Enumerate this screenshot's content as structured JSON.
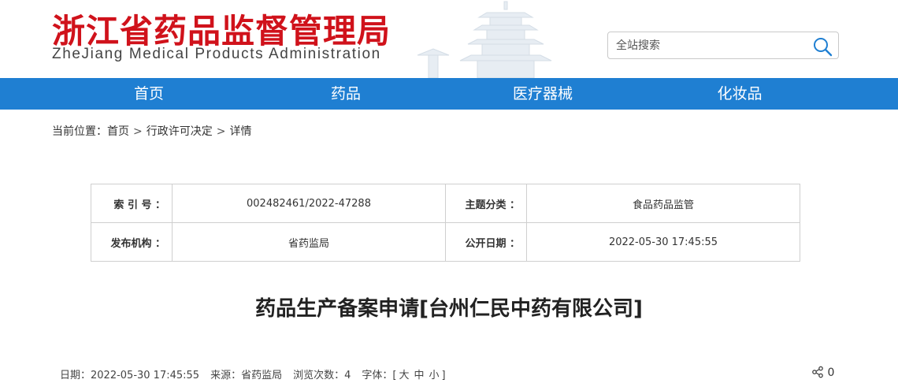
{
  "header": {
    "title_cn": "浙江省药品监督管理局",
    "title_en": "ZheJiang Medical Products Administration",
    "brand_color": "#d0121b",
    "search": {
      "placeholder": "全站搜索",
      "icon": "search-icon"
    }
  },
  "nav": {
    "bg_color": "#1f7fd2",
    "items": [
      {
        "label": "首页"
      },
      {
        "label": "药品"
      },
      {
        "label": "医疗器械"
      },
      {
        "label": "化妆品"
      }
    ]
  },
  "breadcrumb": {
    "prefix": "当前位置：",
    "items": [
      "首页",
      "行政许可决定",
      "详情"
    ],
    "separator": ">"
  },
  "info": {
    "rows": [
      [
        {
          "label": "索 引 号 ：",
          "value": "002482461/2022-47288"
        },
        {
          "label": "主题分类 ：",
          "value": "食品药品监管"
        }
      ],
      [
        {
          "label": "发布机构 ：",
          "value": "省药监局"
        },
        {
          "label": "公开日期 ：",
          "value": "2022-05-30 17:45:55"
        }
      ]
    ]
  },
  "article": {
    "title": "药品生产备案申请[台州仁民中药有限公司]",
    "meta": {
      "date": "日期：2022-05-30 17:45:55",
      "source": "来源：省药监局",
      "views": "浏览次数：4",
      "font_label": "字体：[",
      "font_large": "大",
      "font_medium": "中",
      "font_small": "小",
      "font_close": "]"
    },
    "share_count": "0"
  }
}
